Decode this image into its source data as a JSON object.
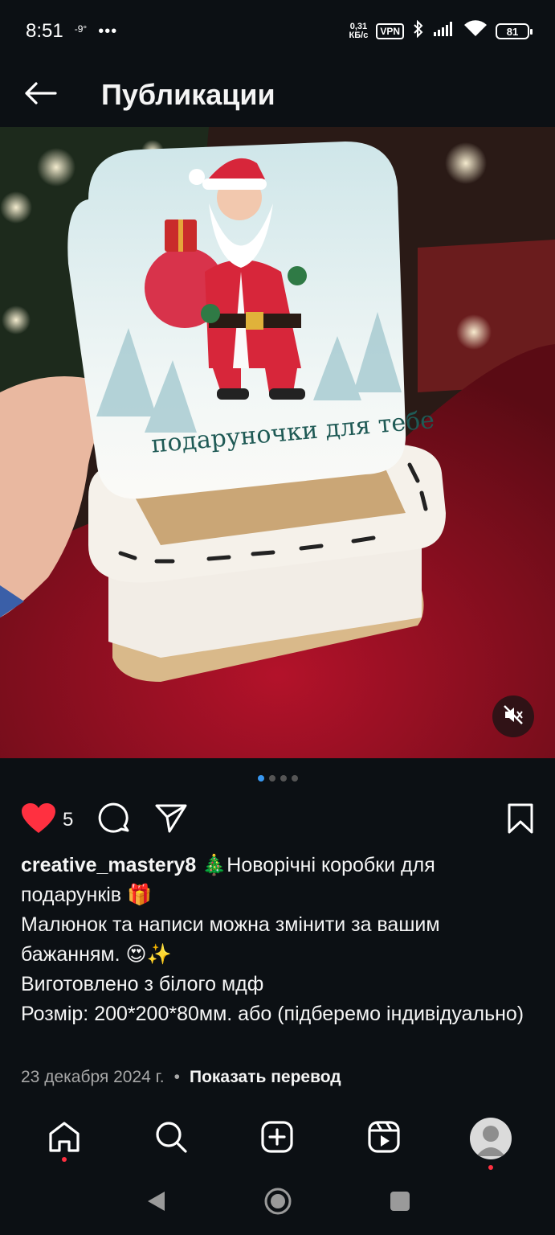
{
  "status_bar": {
    "time": "8:51",
    "temperature": "-9°",
    "overflow": "•••",
    "net_speed_value": "0,31",
    "net_speed_unit": "КБ/с",
    "vpn": "VPN",
    "battery": "81"
  },
  "header": {
    "title": "Публикации",
    "back_icon": "arrow-left-icon"
  },
  "post": {
    "image_text": "подаруночки для тебе",
    "carousel_pages": 4,
    "carousel_active": 1,
    "mute_icon": "speaker-muted-icon",
    "likes": "5",
    "username": "creative_mastery8",
    "caption_lines": [
      " 🎄Новорічні коробки для подарунків 🎁",
      "Малюнок та написи можна змінити за вашим бажанням. 😍✨",
      "Виготовлено з білого мдф",
      "Розмір: 200*200*80мм. або (підберемо індивідуально)"
    ],
    "date": "23 декабря 2024 г.",
    "separator": "•",
    "translate": "Показать перевод"
  },
  "bottom_nav": {
    "items": [
      "home-icon",
      "search-icon",
      "create-icon",
      "reels-icon",
      "profile-avatar"
    ]
  },
  "colors": {
    "background": "#0c1014",
    "like": "#ff3040",
    "accent": "#3897f0",
    "secondary_text": "#a8a8a8"
  }
}
